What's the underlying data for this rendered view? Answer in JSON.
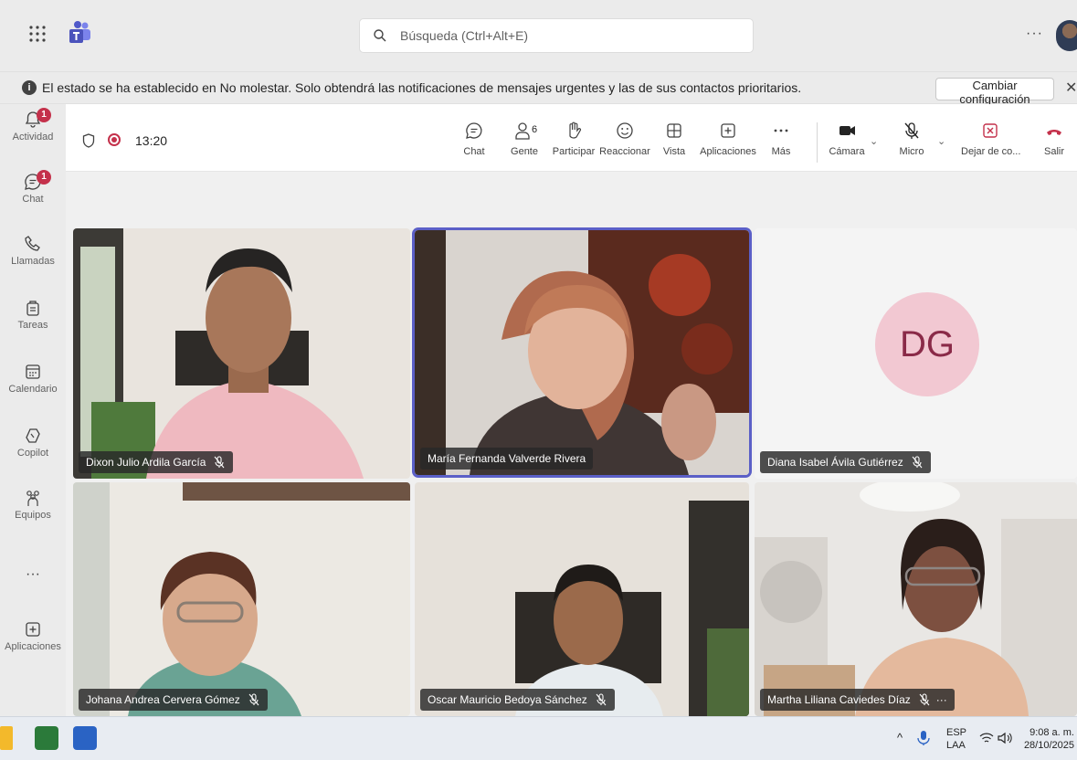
{
  "search": {
    "placeholder": "Búsqueda (Ctrl+Alt+E)"
  },
  "titlebar": {
    "more": "···"
  },
  "banner": {
    "message": "El estado se ha establecido en No molestar. Solo obtendrá las notificaciones de mensajes urgentes y las de sus contactos prioritarios.",
    "button": "Cambiar configuración",
    "close": "✕"
  },
  "rail": [
    {
      "id": "actividad",
      "label": "Actividad",
      "badge": "1"
    },
    {
      "id": "chat",
      "label": "Chat",
      "badge": "1"
    },
    {
      "id": "llamadas",
      "label": "Llamadas"
    },
    {
      "id": "tareas",
      "label": "Tareas"
    },
    {
      "id": "calendario",
      "label": "Calendario"
    },
    {
      "id": "copilot",
      "label": "Copilot"
    },
    {
      "id": "equipos",
      "label": "Equipos"
    },
    {
      "id": "mas",
      "label": "···"
    },
    {
      "id": "aplicaciones",
      "label": "Aplicaciones"
    }
  ],
  "meeting": {
    "timer": "13:20",
    "people_count": "6",
    "toolbar": {
      "chat": "Chat",
      "gente": "Gente",
      "participar": "Participar",
      "reaccionar": "Reaccionar",
      "vista": "Vista",
      "aplicaciones": "Aplicaciones",
      "mas": "Más",
      "camara": "Cámara",
      "micro": "Micro",
      "dejar": "Dejar de co...",
      "salir": "Salir"
    },
    "participants": [
      {
        "name": "Dixon Julio Ardila García",
        "muted": true
      },
      {
        "name": "María Fernanda Valverde Rivera",
        "muted": false,
        "active": true
      },
      {
        "name": "Diana Isabel Ávila Gutiérrez",
        "muted": true,
        "initials": "DG"
      },
      {
        "name": "Johana Andrea Cervera Gómez",
        "muted": true
      },
      {
        "name": "Oscar Mauricio Bedoya Sánchez",
        "muted": true
      },
      {
        "name": "Martha Liliana Caviedes Díaz",
        "muted": true,
        "more": "···"
      }
    ]
  },
  "taskbar": {
    "lang_top": "ESP",
    "lang_bottom": "LAA",
    "time": "9:08 a. m.",
    "date": "28/10/2025"
  },
  "colors": {
    "accent": "#5b5fc7",
    "leave": "#c4314b",
    "badge": "#c4314b"
  }
}
